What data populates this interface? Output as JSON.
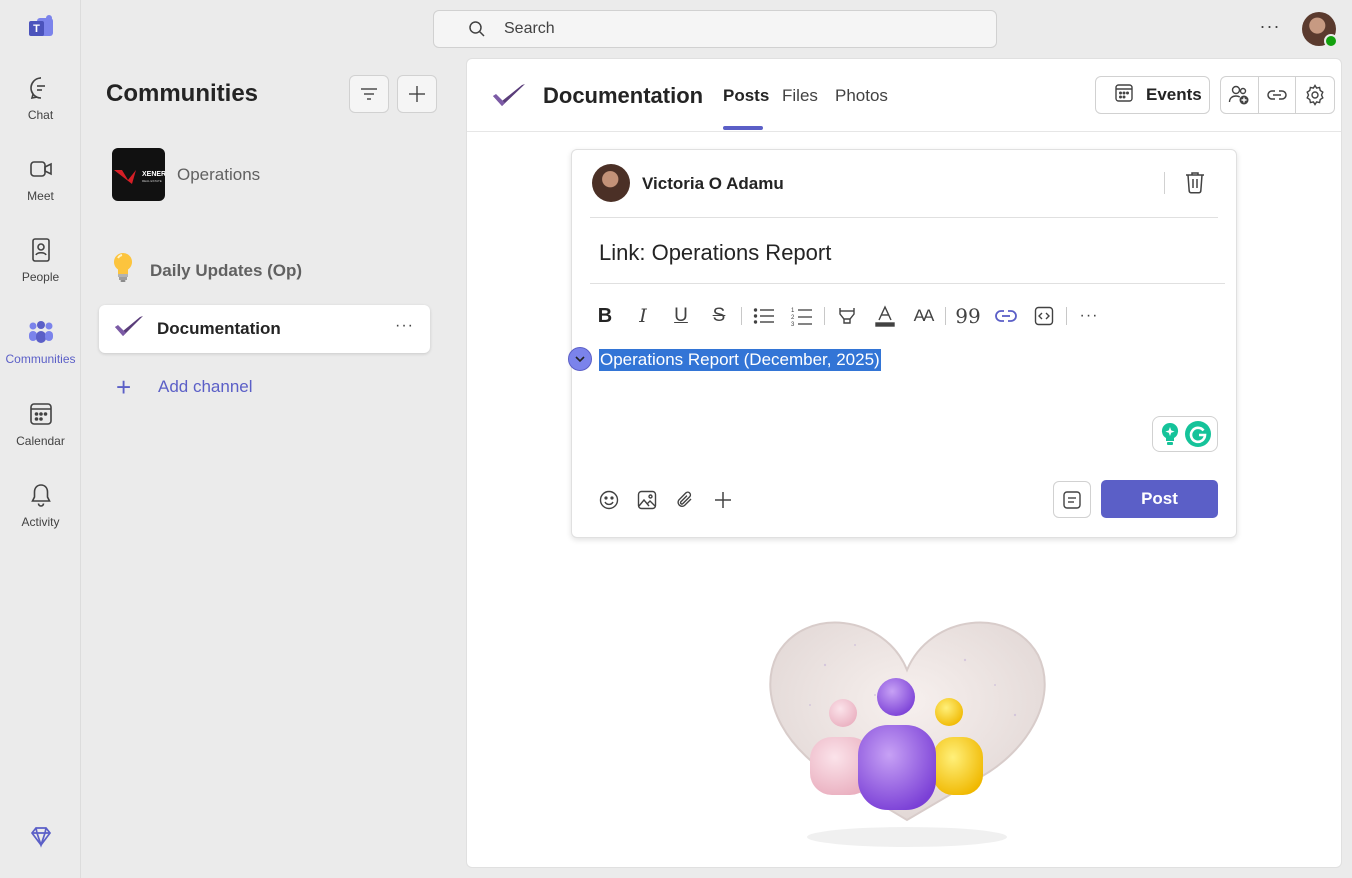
{
  "rail": {
    "items": [
      {
        "label": "Chat",
        "icon": "chat-icon"
      },
      {
        "label": "Meet",
        "icon": "video-camera-icon"
      },
      {
        "label": "People",
        "icon": "contact-book-icon"
      },
      {
        "label": "Communities",
        "icon": "communities-icon"
      },
      {
        "label": "Calendar",
        "icon": "calendar-icon"
      },
      {
        "label": "Activity",
        "icon": "bell-icon"
      }
    ]
  },
  "search": {
    "placeholder": "Search"
  },
  "panel": {
    "title": "Communities",
    "team": {
      "name": "Operations",
      "logo_text": "XENERO"
    },
    "channels": [
      {
        "name": "Daily Updates (Op)"
      },
      {
        "name": "Documentation"
      }
    ],
    "add_channel": "Add channel"
  },
  "main": {
    "title": "Documentation",
    "tabs": [
      {
        "label": "Posts"
      },
      {
        "label": "Files"
      },
      {
        "label": "Photos"
      }
    ],
    "events_label": "Events"
  },
  "compose": {
    "author": "Victoria O Adamu",
    "subject": "Link: Operations Report",
    "body": "Operations Report (December, 2025)",
    "post_label": "Post",
    "toolbar": {
      "bold": "B",
      "italic": "I",
      "underline": "U",
      "strike": "S",
      "font_size": "AA",
      "quote": "99"
    }
  },
  "colors": {
    "accent": "#5b5fc7",
    "selection": "#3375d6",
    "presence": "#13a10e"
  }
}
